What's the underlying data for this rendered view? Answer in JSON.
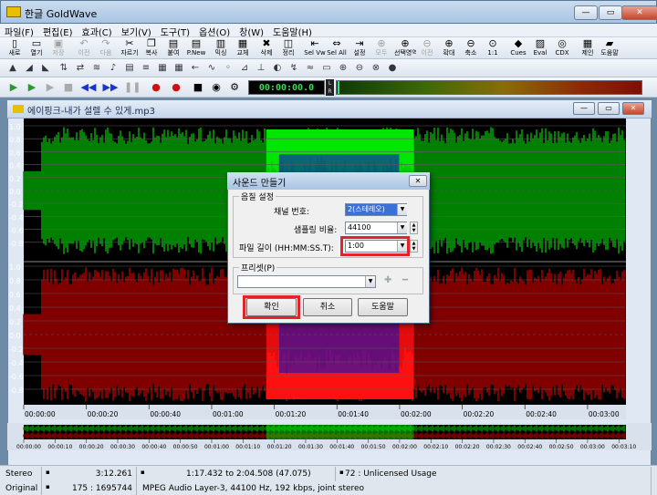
{
  "app": {
    "title": "한글 GoldWave"
  },
  "menu": [
    "파일(F)",
    "편집(E)",
    "효과(C)",
    "보기(V)",
    "도구(T)",
    "옵션(O)",
    "창(W)",
    "도움말(H)"
  ],
  "toolbar": [
    {
      "label": "새로",
      "icon": "new-icon",
      "enabled": true
    },
    {
      "label": "열기",
      "icon": "open-icon",
      "enabled": true
    },
    {
      "label": "저장",
      "icon": "save-icon",
      "enabled": false
    },
    {
      "label": "이전",
      "icon": "undo-icon",
      "enabled": false
    },
    {
      "label": "다음",
      "icon": "redo-icon",
      "enabled": false
    },
    {
      "label": "자르기",
      "icon": "cut-icon",
      "enabled": true
    },
    {
      "label": "복사",
      "icon": "copy-icon",
      "enabled": true
    },
    {
      "label": "붙여",
      "icon": "paste-icon",
      "enabled": true
    },
    {
      "label": "P.New",
      "icon": "paste-new-icon",
      "enabled": true
    },
    {
      "label": "믹싱",
      "icon": "mix-icon",
      "enabled": true
    },
    {
      "label": "교체",
      "icon": "replace-icon",
      "enabled": true
    },
    {
      "label": "삭제",
      "icon": "delete-icon",
      "enabled": true
    },
    {
      "label": "정리",
      "icon": "trim-icon",
      "enabled": true
    },
    {
      "label": "Sel Vw",
      "icon": "select-view-icon",
      "enabled": true
    },
    {
      "label": "Sel All",
      "icon": "select-all-icon",
      "enabled": true
    },
    {
      "label": "설정",
      "icon": "set-icon",
      "enabled": true
    },
    {
      "label": "모두",
      "icon": "all-icon",
      "enabled": false
    },
    {
      "label": "선택영역",
      "icon": "selection-icon",
      "enabled": true
    },
    {
      "label": "이전",
      "icon": "previous-icon",
      "enabled": false
    },
    {
      "label": "확대",
      "icon": "zoom-in-icon",
      "enabled": true
    },
    {
      "label": "축소",
      "icon": "zoom-out-icon",
      "enabled": true
    },
    {
      "label": "1:1",
      "icon": "zoom-actual-icon",
      "enabled": true
    },
    {
      "label": "Cues",
      "icon": "cues-icon",
      "enabled": true
    },
    {
      "label": "Eval",
      "icon": "eval-icon",
      "enabled": true
    },
    {
      "label": "CDX",
      "icon": "cd-extract-icon",
      "enabled": true
    },
    {
      "label": "제인",
      "icon": "control-icon",
      "enabled": true
    },
    {
      "label": "도움말",
      "icon": "help-book-icon",
      "enabled": true
    }
  ],
  "counter": "00:00:00.0",
  "meter": {
    "channels": [
      "L",
      "R"
    ],
    "level": 0
  },
  "document": {
    "title": "에이핑크-내가 설렐 수 있게.mp3"
  },
  "waveform": {
    "y_ticks": [
      "1.0",
      "0.8",
      "0.6",
      "0.4",
      "0.2",
      "0.0",
      "-0.2",
      "-0.4",
      "-0.6",
      "-0.8"
    ],
    "time_ticks": [
      "00:00:00",
      "00:00:20",
      "00:00:40",
      "00:01:00",
      "00:01:20",
      "00:01:40",
      "00:02:00",
      "00:02:20",
      "00:02:40",
      "00:03:00"
    ],
    "overview_ticks": [
      "00:00:00",
      "00:00:10",
      "00:00:20",
      "00:00:30",
      "00:00:40",
      "00:00:50",
      "00:01:00",
      "00:01:10",
      "00:01:20",
      "00:01:30",
      "00:01:40",
      "00:01:50",
      "00:02:00",
      "00:02:10",
      "00:02:20",
      "00:02:30",
      "00:02:40",
      "00:02:50",
      "00:03:00",
      "00:03:10"
    ],
    "colors": {
      "left": "#00a000",
      "right": "#a00000",
      "left_selected": "#00e600",
      "right_selected": "#ff1010",
      "selected_peak": "#1010c0"
    },
    "duration_s": 192.26,
    "selection_s": [
      77.43,
      124.51
    ]
  },
  "dialog": {
    "title": "사운드 만들기",
    "group_quality": "음질 설정",
    "channels_label": "채널 번호:",
    "channels_value": "2(스테레오)",
    "rate_label": "샘플링 비율:",
    "rate_value": "44100",
    "length_label": "파일 길이 (HH:MM:SS.T):",
    "length_value": "1:00",
    "preset_label": "프리셋(P)",
    "preset_value": "",
    "ok": "확인",
    "cancel": "취소",
    "help": "도움말"
  },
  "status": {
    "row1": [
      "Stereo",
      "3:12.261",
      "1:17.432 to 2:04.508 (47.075)",
      "72 : Unlicensed Usage"
    ],
    "row2": [
      "Original",
      "175 : 1695744",
      "MPEG Audio Layer-3, 44100 Hz, 192 kbps, joint stereo"
    ]
  }
}
